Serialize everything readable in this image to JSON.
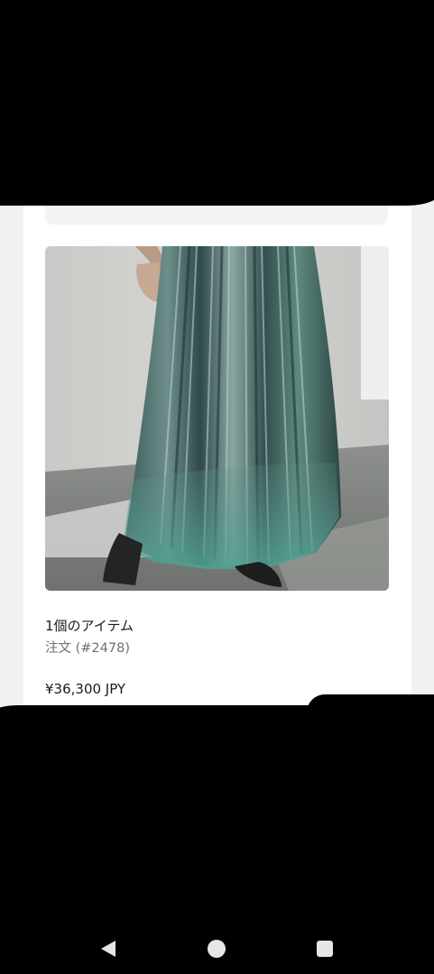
{
  "order_card": {
    "items_count_label": "1個のアイテム",
    "order_label": "注文 (#2478)",
    "price": "¥36,300 JPY"
  },
  "product_image": {
    "description_icon": "pleated-skirt-photo"
  },
  "navigation_bar": {
    "back_icon": "back-triangle-icon",
    "home_icon": "home-circle-icon",
    "recents_icon": "recents-square-icon"
  },
  "colors": {
    "page_background": "#f1f1f3",
    "card_background": "#ffffff",
    "text_primary": "#1b1b1b",
    "text_secondary": "#707070",
    "nav_bar": "#000000"
  }
}
